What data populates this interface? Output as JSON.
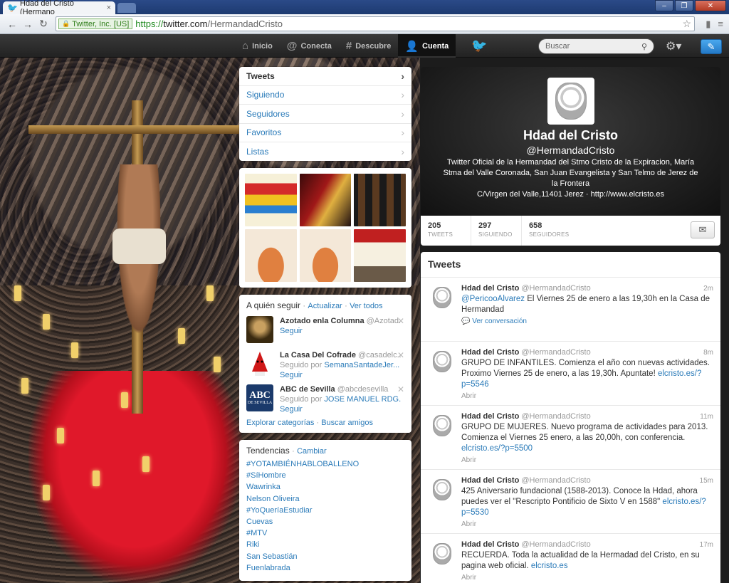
{
  "browser": {
    "tab_title": "Hdad del Cristo (Hermano",
    "tab_close": "×",
    "cert": "Twitter, Inc. [US]",
    "url_scheme": "https://",
    "url_host": "twitter.com",
    "url_path": "/HermandadCristo"
  },
  "topbar": {
    "nav": [
      {
        "label": "Inicio",
        "icon": "home-icon"
      },
      {
        "label": "Conecta",
        "icon": "at-icon"
      },
      {
        "label": "Descubre",
        "icon": "hashtag-icon"
      },
      {
        "label": "Cuenta",
        "icon": "user-icon"
      }
    ],
    "search_placeholder": "Buscar"
  },
  "navlist": [
    "Tweets",
    "Siguiendo",
    "Seguidores",
    "Favoritos",
    "Listas"
  ],
  "who_to_follow": {
    "title": "A quién seguir",
    "refresh": "Actualizar",
    "view_all": "Ver todos",
    "suggestions": [
      {
        "name": "Azotado enla Columna",
        "handle": "@Azotad...",
        "followed_by_prefix": "",
        "followed_by": "",
        "follow": "Seguir"
      },
      {
        "name": "La Casa Del Cofrade",
        "handle": "@casadelc...",
        "followed_by_prefix": "Seguido por",
        "followed_by": "SemanaSantadeJer...",
        "follow": "Seguir"
      },
      {
        "name": "ABC de Sevilla",
        "handle": "@abcdesevilla",
        "followed_by_prefix": "Seguido por",
        "followed_by": "JOSE MANUEL RDG...",
        "follow": "Seguir"
      }
    ],
    "explore": "Explorar categorías",
    "find_friends": "Buscar amigos",
    "abc_logo_top": "ABC",
    "abc_logo_bottom": "DE SEVILLA"
  },
  "trends": {
    "title": "Tendencias",
    "change": "Cambiar",
    "items": [
      "#YOTAMBIÉNHABLOBALLENO",
      "#SíHombre",
      "Wawrinka",
      "Nelson Oliveira",
      "#YoQueríaEstudiar",
      "Cuevas",
      "#MTV",
      "Riki",
      "San Sebastián",
      "Fuenlabrada"
    ]
  },
  "profile": {
    "name": "Hdad del Cristo",
    "handle": "@HermandadCristo",
    "bio": "Twitter Oficial de la Hermandad del Stmo Cristo de la Expiracion, María Stma del Valle Coronada, San Juan Evangelista y San Telmo de Jerez de la Frontera",
    "location": "C/Virgen del Valle,11401 Jerez",
    "sep": "·",
    "website": "http://www.elcristo.es",
    "stats": [
      {
        "value": "205",
        "label": "TWEETS"
      },
      {
        "value": "297",
        "label": "SIGUIENDO"
      },
      {
        "value": "658",
        "label": "SEGUIDORES"
      }
    ]
  },
  "timeline": {
    "title": "Tweets",
    "tweets": [
      {
        "name": "Hdad del Cristo",
        "handle": "@HermandadCristo",
        "time": "2m",
        "mention": "@PericooAlvarez",
        "text": " El Viernes 25 de enero a las 19,30h en la Casa de Hermandad",
        "link": "",
        "action": "Ver conversación"
      },
      {
        "name": "Hdad del Cristo",
        "handle": "@HermandadCristo",
        "time": "8m",
        "mention": "",
        "text": "GRUPO DE INFANTILES. Comienza el año con nuevas actividades. Proximo Viernes 25 de enero, a las 19,30h. Apuntate! ",
        "link": "elcristo.es/?p=5546",
        "action": "Abrir"
      },
      {
        "name": "Hdad del Cristo",
        "handle": "@HermandadCristo",
        "time": "11m",
        "mention": "",
        "text": "GRUPO DE MUJERES. Nuevo programa de actividades para 2013. Comienza el Viernes 25 enero, a las 20,00h, con conferencia. ",
        "link": "elcristo.es/?p=5500",
        "action": "Abrir"
      },
      {
        "name": "Hdad del Cristo",
        "handle": "@HermandadCristo",
        "time": "15m",
        "mention": "",
        "text": "425 Aniversario fundacional (1588-2013). Conoce la Hdad, ahora puedes ver el \"Rescripto Pontificio de Sixto V en 1588\" ",
        "link": "elcristo.es/?p=5530",
        "action": "Abrir"
      },
      {
        "name": "Hdad del Cristo",
        "handle": "@HermandadCristo",
        "time": "17m",
        "mention": "",
        "text": "RECUERDA. Toda la actualidad de la Hermadad del Cristo, en su pagina web oficial. ",
        "link": "elcristo.es",
        "action": "Abrir"
      }
    ]
  }
}
